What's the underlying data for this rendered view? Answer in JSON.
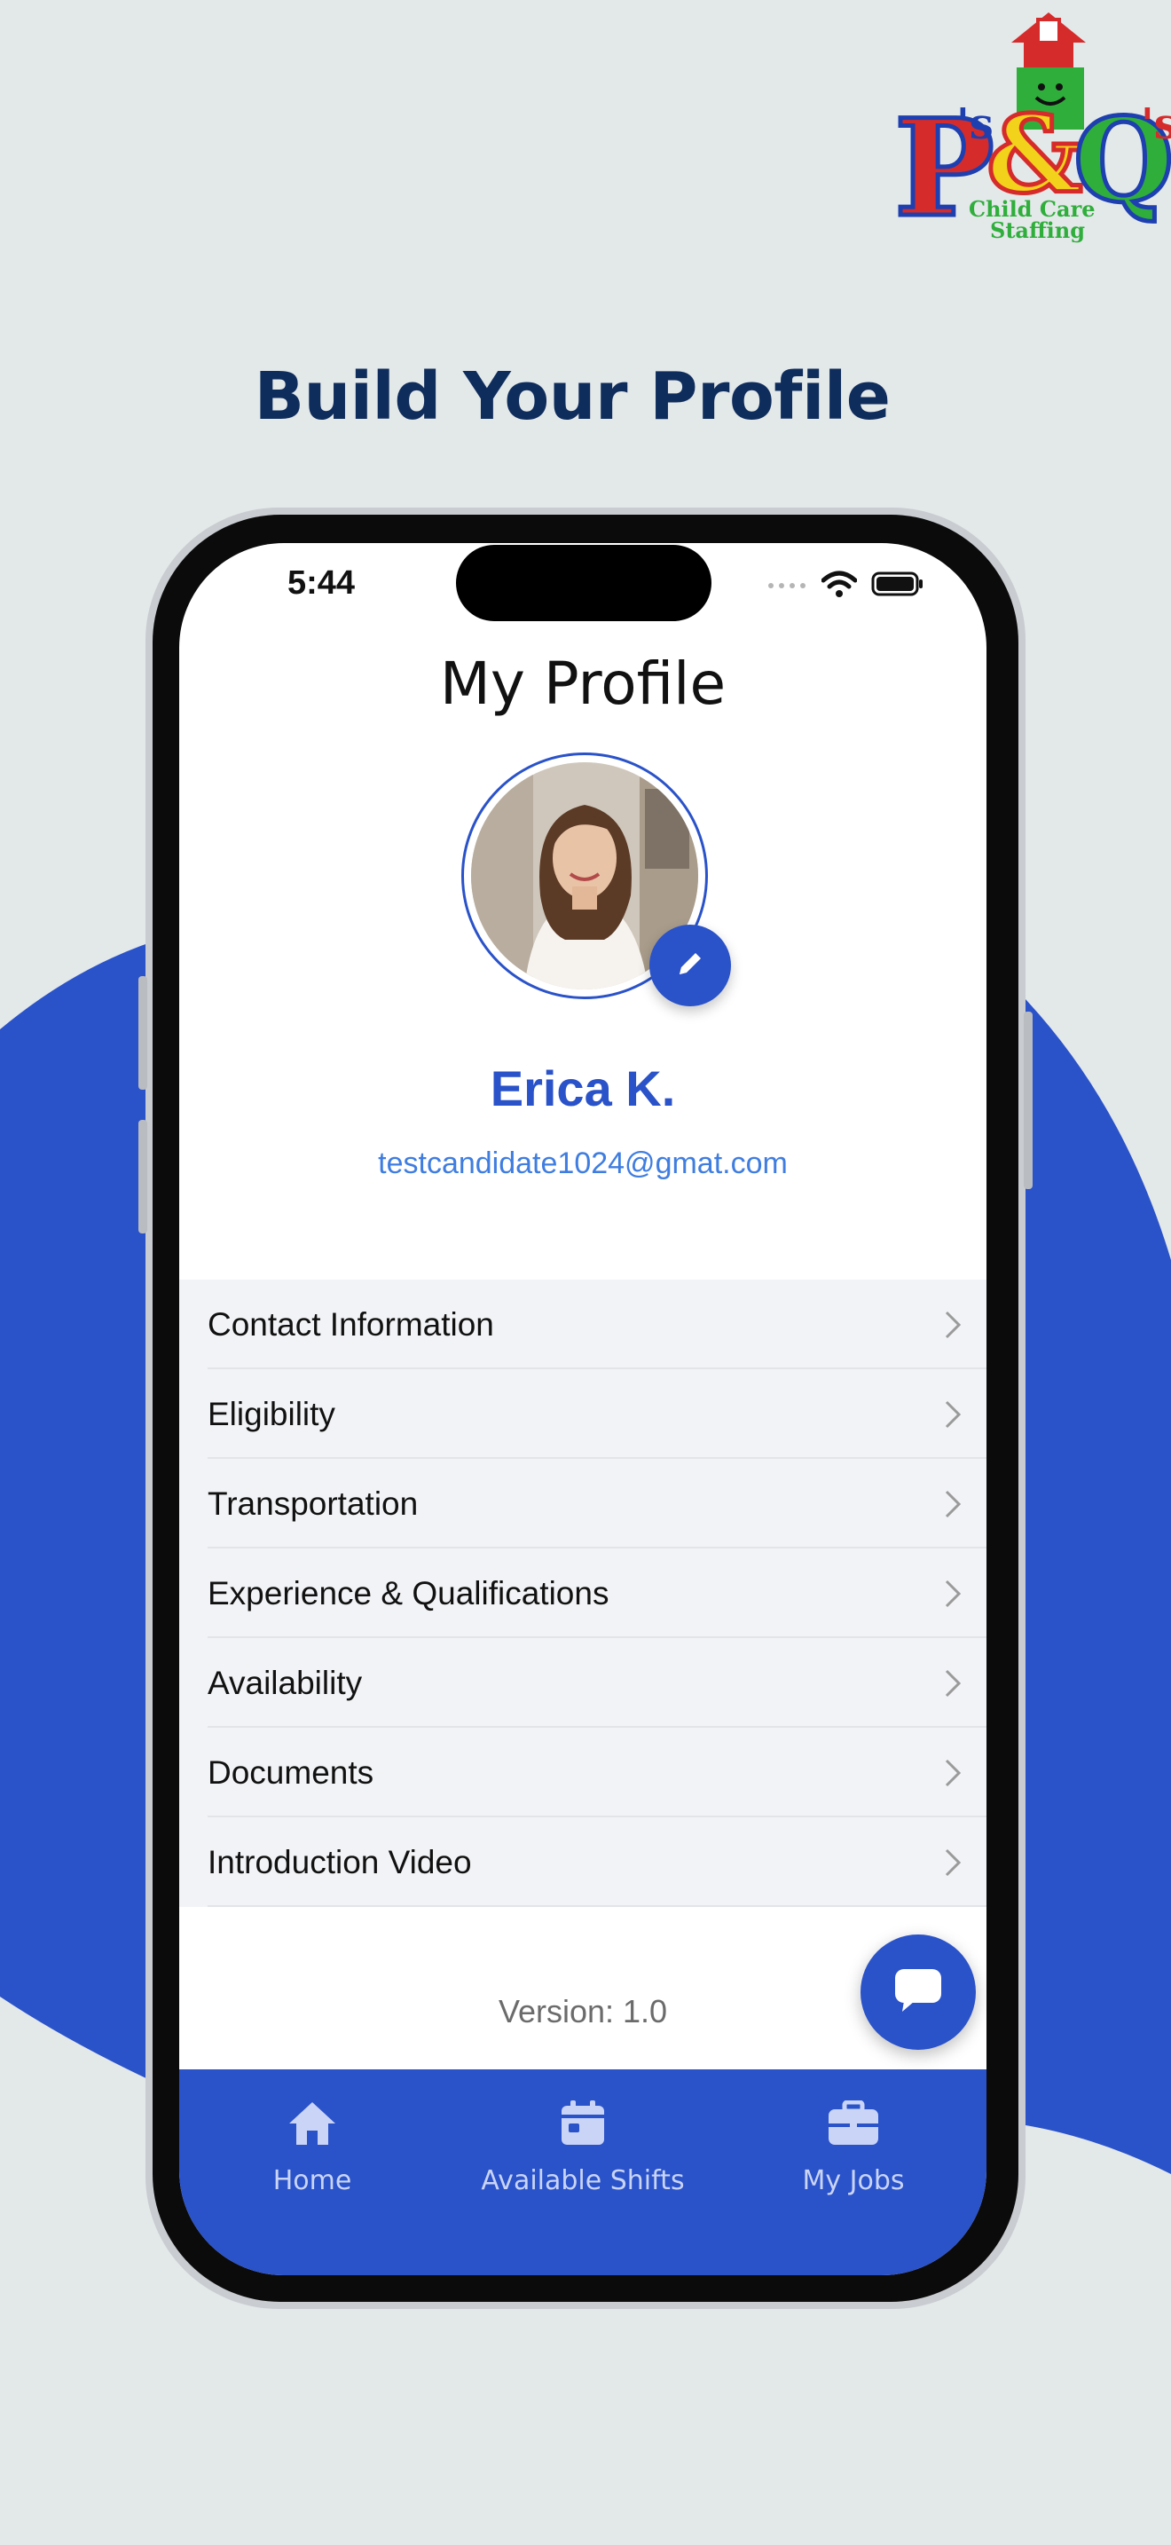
{
  "logo": {
    "brand_text": "P's & Q's",
    "tagline_line1": "Child Care",
    "tagline_line2": "Staffing"
  },
  "headline": "Build Your Profile",
  "status_bar": {
    "time": "5:44",
    "icons": [
      "signal-icon",
      "wifi-icon",
      "battery-icon"
    ]
  },
  "profile": {
    "title": "My Profile",
    "name": "Erica K.",
    "email": "testcandidate1024@gmat.com",
    "edit_icon": "pencil-icon"
  },
  "menu": {
    "items": [
      {
        "label": "Contact Information"
      },
      {
        "label": "Eligibility"
      },
      {
        "label": "Transportation"
      },
      {
        "label": "Experience & Qualifications"
      },
      {
        "label": "Availability"
      },
      {
        "label": "Documents"
      },
      {
        "label": "Introduction Video"
      }
    ],
    "chevron_icon": "chevron-right-icon"
  },
  "version_label": "Version: 1.0",
  "chat_icon": "chat-icon",
  "tab_bar": {
    "tabs": [
      {
        "label": "Home",
        "icon": "home-icon"
      },
      {
        "label": "Available Shifts",
        "icon": "calendar-icon"
      },
      {
        "label": "My Jobs",
        "icon": "briefcase-icon"
      }
    ]
  },
  "colors": {
    "brand_blue": "#2a52c9",
    "headline_navy": "#0f2d5c",
    "email_blue": "#3f7de0",
    "background": "#e3e8e9"
  }
}
